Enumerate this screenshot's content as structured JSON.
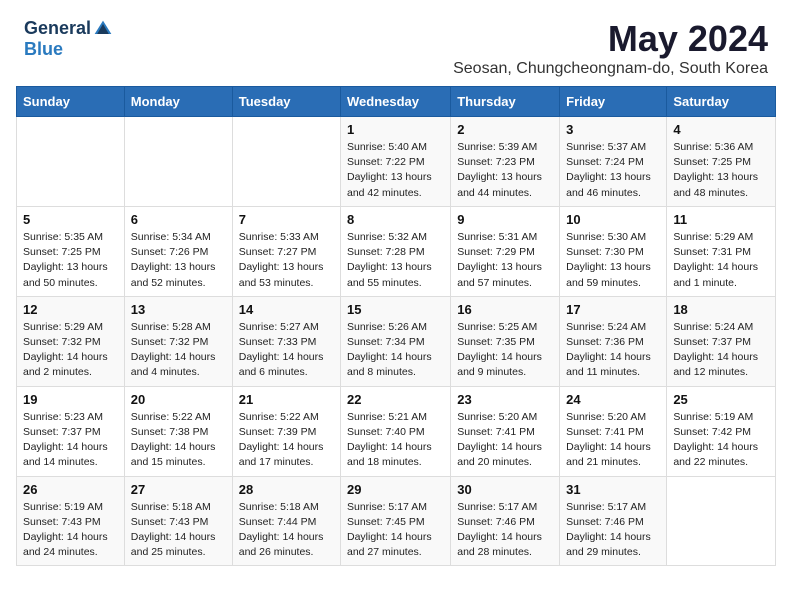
{
  "logo": {
    "general": "General",
    "blue": "Blue"
  },
  "title": {
    "month": "May 2024",
    "location": "Seosan, Chungcheongnam-do, South Korea"
  },
  "weekdays": [
    "Sunday",
    "Monday",
    "Tuesday",
    "Wednesday",
    "Thursday",
    "Friday",
    "Saturday"
  ],
  "weeks": [
    [
      {
        "day": "",
        "info": ""
      },
      {
        "day": "",
        "info": ""
      },
      {
        "day": "",
        "info": ""
      },
      {
        "day": "1",
        "info": "Sunrise: 5:40 AM\nSunset: 7:22 PM\nDaylight: 13 hours\nand 42 minutes."
      },
      {
        "day": "2",
        "info": "Sunrise: 5:39 AM\nSunset: 7:23 PM\nDaylight: 13 hours\nand 44 minutes."
      },
      {
        "day": "3",
        "info": "Sunrise: 5:37 AM\nSunset: 7:24 PM\nDaylight: 13 hours\nand 46 minutes."
      },
      {
        "day": "4",
        "info": "Sunrise: 5:36 AM\nSunset: 7:25 PM\nDaylight: 13 hours\nand 48 minutes."
      }
    ],
    [
      {
        "day": "5",
        "info": "Sunrise: 5:35 AM\nSunset: 7:25 PM\nDaylight: 13 hours\nand 50 minutes."
      },
      {
        "day": "6",
        "info": "Sunrise: 5:34 AM\nSunset: 7:26 PM\nDaylight: 13 hours\nand 52 minutes."
      },
      {
        "day": "7",
        "info": "Sunrise: 5:33 AM\nSunset: 7:27 PM\nDaylight: 13 hours\nand 53 minutes."
      },
      {
        "day": "8",
        "info": "Sunrise: 5:32 AM\nSunset: 7:28 PM\nDaylight: 13 hours\nand 55 minutes."
      },
      {
        "day": "9",
        "info": "Sunrise: 5:31 AM\nSunset: 7:29 PM\nDaylight: 13 hours\nand 57 minutes."
      },
      {
        "day": "10",
        "info": "Sunrise: 5:30 AM\nSunset: 7:30 PM\nDaylight: 13 hours\nand 59 minutes."
      },
      {
        "day": "11",
        "info": "Sunrise: 5:29 AM\nSunset: 7:31 PM\nDaylight: 14 hours\nand 1 minute."
      }
    ],
    [
      {
        "day": "12",
        "info": "Sunrise: 5:29 AM\nSunset: 7:32 PM\nDaylight: 14 hours\nand 2 minutes."
      },
      {
        "day": "13",
        "info": "Sunrise: 5:28 AM\nSunset: 7:32 PM\nDaylight: 14 hours\nand 4 minutes."
      },
      {
        "day": "14",
        "info": "Sunrise: 5:27 AM\nSunset: 7:33 PM\nDaylight: 14 hours\nand 6 minutes."
      },
      {
        "day": "15",
        "info": "Sunrise: 5:26 AM\nSunset: 7:34 PM\nDaylight: 14 hours\nand 8 minutes."
      },
      {
        "day": "16",
        "info": "Sunrise: 5:25 AM\nSunset: 7:35 PM\nDaylight: 14 hours\nand 9 minutes."
      },
      {
        "day": "17",
        "info": "Sunrise: 5:24 AM\nSunset: 7:36 PM\nDaylight: 14 hours\nand 11 minutes."
      },
      {
        "day": "18",
        "info": "Sunrise: 5:24 AM\nSunset: 7:37 PM\nDaylight: 14 hours\nand 12 minutes."
      }
    ],
    [
      {
        "day": "19",
        "info": "Sunrise: 5:23 AM\nSunset: 7:37 PM\nDaylight: 14 hours\nand 14 minutes."
      },
      {
        "day": "20",
        "info": "Sunrise: 5:22 AM\nSunset: 7:38 PM\nDaylight: 14 hours\nand 15 minutes."
      },
      {
        "day": "21",
        "info": "Sunrise: 5:22 AM\nSunset: 7:39 PM\nDaylight: 14 hours\nand 17 minutes."
      },
      {
        "day": "22",
        "info": "Sunrise: 5:21 AM\nSunset: 7:40 PM\nDaylight: 14 hours\nand 18 minutes."
      },
      {
        "day": "23",
        "info": "Sunrise: 5:20 AM\nSunset: 7:41 PM\nDaylight: 14 hours\nand 20 minutes."
      },
      {
        "day": "24",
        "info": "Sunrise: 5:20 AM\nSunset: 7:41 PM\nDaylight: 14 hours\nand 21 minutes."
      },
      {
        "day": "25",
        "info": "Sunrise: 5:19 AM\nSunset: 7:42 PM\nDaylight: 14 hours\nand 22 minutes."
      }
    ],
    [
      {
        "day": "26",
        "info": "Sunrise: 5:19 AM\nSunset: 7:43 PM\nDaylight: 14 hours\nand 24 minutes."
      },
      {
        "day": "27",
        "info": "Sunrise: 5:18 AM\nSunset: 7:43 PM\nDaylight: 14 hours\nand 25 minutes."
      },
      {
        "day": "28",
        "info": "Sunrise: 5:18 AM\nSunset: 7:44 PM\nDaylight: 14 hours\nand 26 minutes."
      },
      {
        "day": "29",
        "info": "Sunrise: 5:17 AM\nSunset: 7:45 PM\nDaylight: 14 hours\nand 27 minutes."
      },
      {
        "day": "30",
        "info": "Sunrise: 5:17 AM\nSunset: 7:46 PM\nDaylight: 14 hours\nand 28 minutes."
      },
      {
        "day": "31",
        "info": "Sunrise: 5:17 AM\nSunset: 7:46 PM\nDaylight: 14 hours\nand 29 minutes."
      },
      {
        "day": "",
        "info": ""
      }
    ]
  ]
}
